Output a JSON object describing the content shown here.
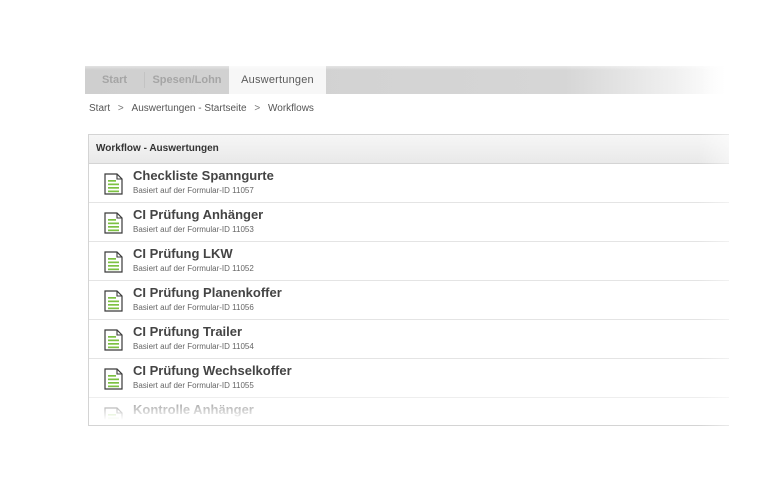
{
  "tabs": [
    {
      "label": "Start",
      "active": false
    },
    {
      "label": "Spesen/Lohn",
      "active": false
    },
    {
      "label": "Auswertungen",
      "active": true
    }
  ],
  "breadcrumb": {
    "items": [
      "Start",
      "Auswertungen - Startseite",
      "Workflows"
    ],
    "separator": ">"
  },
  "panel": {
    "title": "Workflow - Auswertungen"
  },
  "workflows": [
    {
      "title": "Checkliste Spanngurte",
      "subtitle": "Basiert auf der Formular-ID 11057"
    },
    {
      "title": "CI Prüfung Anhänger",
      "subtitle": "Basiert auf der Formular-ID 11053"
    },
    {
      "title": "CI Prüfung LKW",
      "subtitle": "Basiert auf der Formular-ID 11052"
    },
    {
      "title": "CI Prüfung Planenkoffer",
      "subtitle": "Basiert auf der Formular-ID 11056"
    },
    {
      "title": "CI Prüfung Trailer",
      "subtitle": "Basiert auf der Formular-ID 11054"
    },
    {
      "title": "CI Prüfung Wechselkoffer",
      "subtitle": "Basiert auf der Formular-ID 11055"
    },
    {
      "title": "Kontrolle Anhänger",
      "subtitle": ""
    }
  ],
  "icons": {
    "document": "document-icon"
  },
  "colors": {
    "icon_green": "#7cc142",
    "tab_bar": "#d3d3d3",
    "active_tab": "#f7f7f7"
  }
}
